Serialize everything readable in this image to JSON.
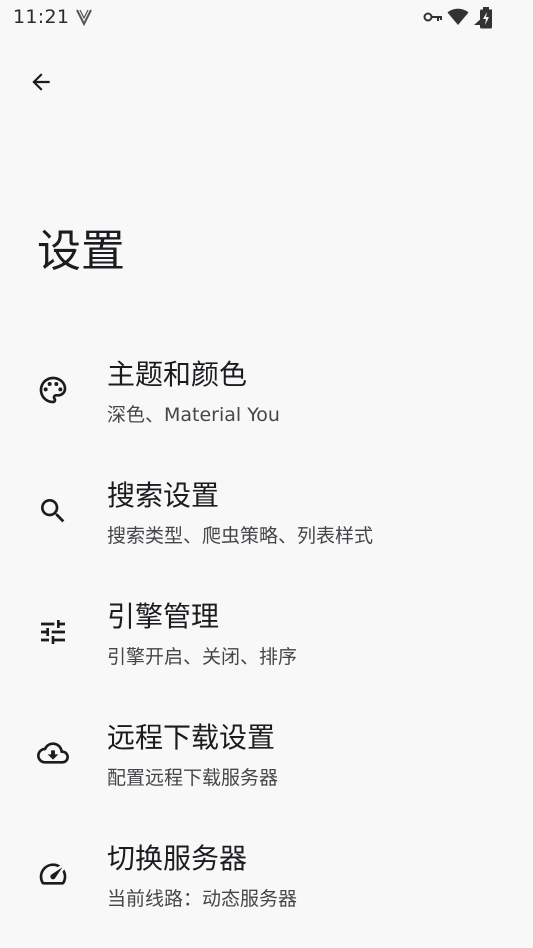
{
  "status_bar": {
    "time": "11:21",
    "icons": [
      "v-icon",
      "vpn-key-icon",
      "wifi-icon",
      "signal-icon",
      "battery-charging-icon"
    ]
  },
  "header": {
    "title": "设置",
    "back_icon": "arrow-back-icon"
  },
  "settings": {
    "items": [
      {
        "icon": "palette-icon",
        "title": "主题和颜色",
        "subtitle": "深色、Material You"
      },
      {
        "icon": "search-icon",
        "title": "搜索设置",
        "subtitle": "搜索类型、爬虫策略、列表样式"
      },
      {
        "icon": "tune-icon",
        "title": "引擎管理",
        "subtitle": "引擎开启、关闭、排序"
      },
      {
        "icon": "cloud-download-icon",
        "title": "远程下载设置",
        "subtitle": "配置远程下载服务器"
      },
      {
        "icon": "speed-icon",
        "title": "切换服务器",
        "subtitle": "当前线路：动态服务器"
      }
    ]
  },
  "colors": {
    "background": "#f8f8f8",
    "text_primary": "#1c1b1f",
    "text_secondary": "#46464a"
  }
}
